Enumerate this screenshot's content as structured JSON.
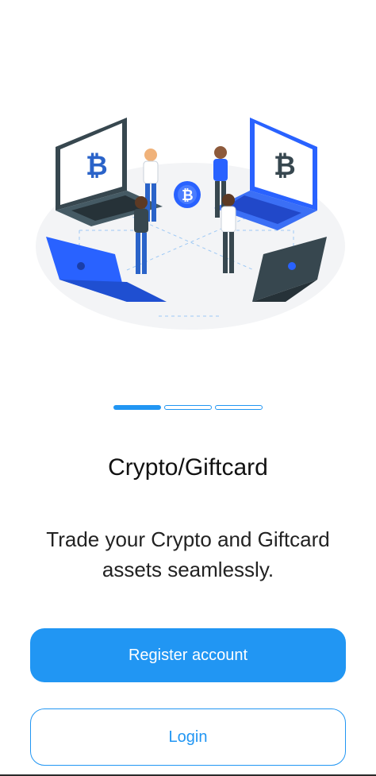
{
  "onboarding": {
    "title": "Crypto/Giftcard",
    "subtitle": "Trade your Crypto and Giftcard assets seamlessly.",
    "register_label": "Register account",
    "login_label": "Login",
    "pager": {
      "pages": 3,
      "current": 1
    }
  },
  "colors": {
    "accent": "#2196f3",
    "dark": "#37474f",
    "text": "#111111"
  }
}
